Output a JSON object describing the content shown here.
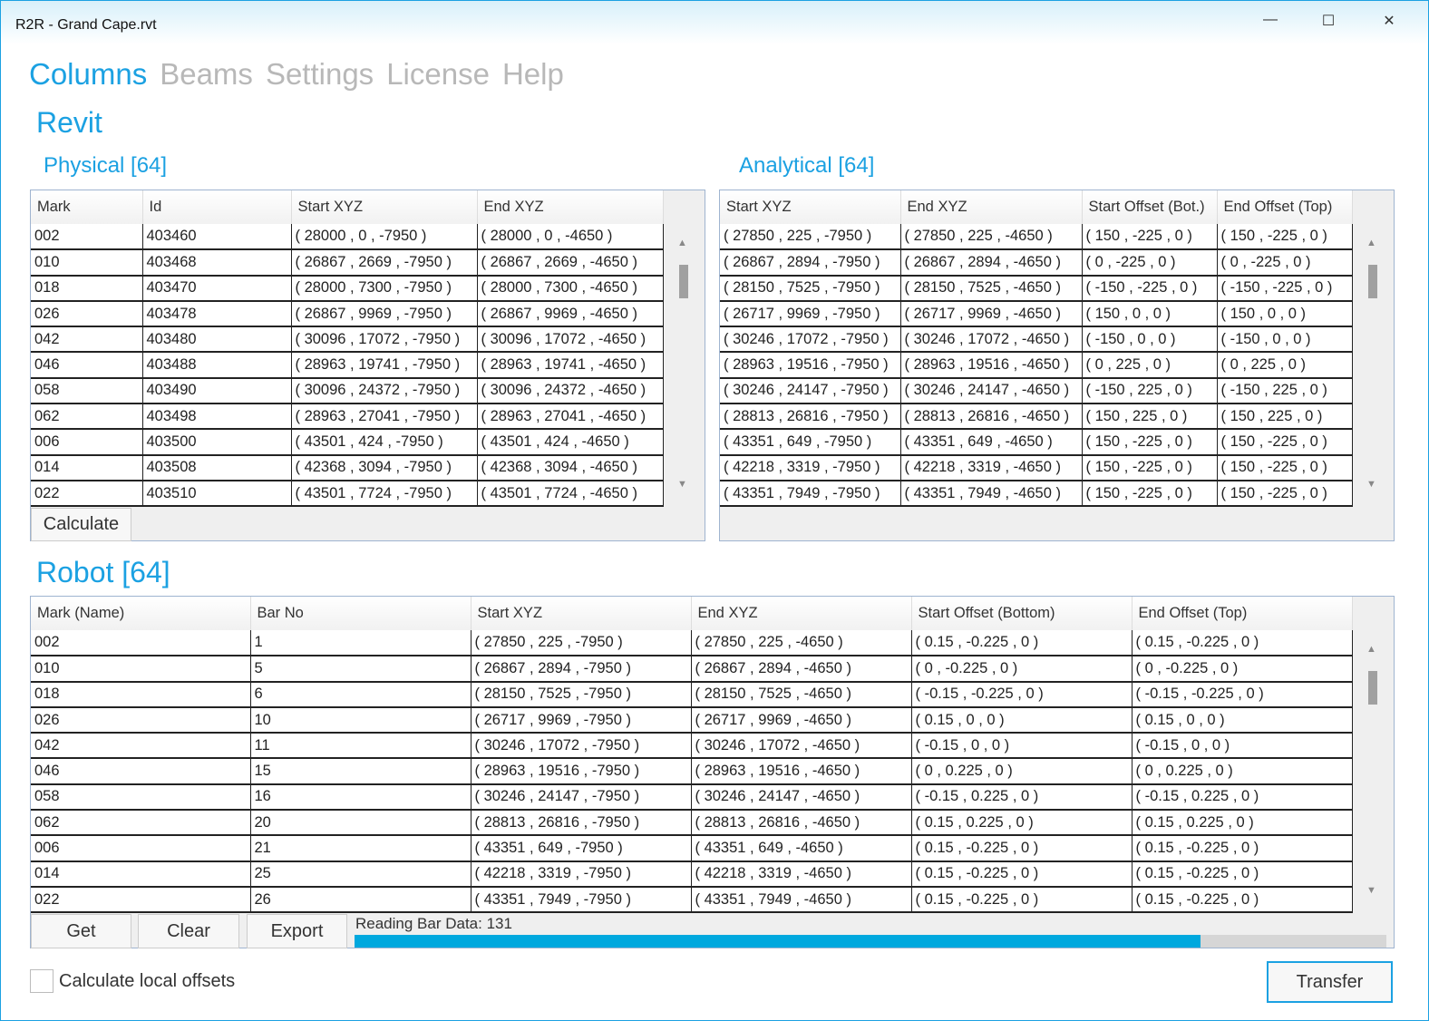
{
  "window": {
    "title": "R2R - Grand Cape.rvt",
    "minimize": "—",
    "maximize": "☐",
    "close": "✕"
  },
  "nav": [
    {
      "label": "Columns",
      "active": true
    },
    {
      "label": "Beams"
    },
    {
      "label": "Settings"
    },
    {
      "label": "License"
    },
    {
      "label": "Help"
    }
  ],
  "revit": {
    "title": "Revit",
    "physical": {
      "title": "Physical [64]",
      "headers": [
        "Mark",
        "Id",
        "Start XYZ",
        "End XYZ"
      ],
      "rows": [
        [
          "002",
          "403460",
          "( 28000 , 0 , -7950 )",
          "( 28000 , 0 , -4650 )"
        ],
        [
          "010",
          "403468",
          "( 26867 , 2669 , -7950 )",
          "( 26867 , 2669 , -4650 )"
        ],
        [
          "018",
          "403470",
          "( 28000 , 7300 , -7950 )",
          "( 28000 , 7300 , -4650 )"
        ],
        [
          "026",
          "403478",
          "( 26867 , 9969 , -7950 )",
          "( 26867 , 9969 , -4650 )"
        ],
        [
          "042",
          "403480",
          "( 30096 , 17072 , -7950 )",
          "( 30096 , 17072 , -4650 )"
        ],
        [
          "046",
          "403488",
          "( 28963 , 19741 , -7950 )",
          "( 28963 , 19741 , -4650 )"
        ],
        [
          "058",
          "403490",
          "( 30096 , 24372 , -7950 )",
          "( 30096 , 24372 , -4650 )"
        ],
        [
          "062",
          "403498",
          "( 28963 , 27041 , -7950 )",
          "( 28963 , 27041 , -4650 )"
        ],
        [
          "006",
          "403500",
          "( 43501 , 424 , -7950 )",
          "( 43501 , 424 , -4650 )"
        ],
        [
          "014",
          "403508",
          "( 42368 , 3094 , -7950 )",
          "( 42368 , 3094 , -4650 )"
        ],
        [
          "022",
          "403510",
          "( 43501 , 7724 , -7950 )",
          "( 43501 , 7724 , -4650 )"
        ]
      ],
      "calculate": "Calculate"
    },
    "analytical": {
      "title": "Analytical [64]",
      "headers": [
        "Start XYZ",
        "End XYZ",
        "Start Offset (Bot.)",
        "End Offset (Top)"
      ],
      "rows": [
        [
          "( 27850 , 225 , -7950 )",
          "( 27850 , 225 , -4650 )",
          "( 150 , -225 , 0 )",
          "( 150 , -225 , 0 )"
        ],
        [
          "( 26867 , 2894 , -7950 )",
          "( 26867 , 2894 , -4650 )",
          "( 0 , -225 , 0 )",
          "( 0 , -225 , 0 )"
        ],
        [
          "( 28150 , 7525 , -7950 )",
          "( 28150 , 7525 , -4650 )",
          "( -150 , -225 , 0 )",
          "( -150 , -225 , 0 )"
        ],
        [
          "( 26717 , 9969 , -7950 )",
          "( 26717 , 9969 , -4650 )",
          "( 150 , 0 , 0 )",
          "( 150 , 0 , 0 )"
        ],
        [
          "( 30246 , 17072 , -7950 )",
          "( 30246 , 17072 , -4650 )",
          "( -150 , 0 , 0 )",
          "( -150 , 0 , 0 )"
        ],
        [
          "( 28963 , 19516 , -7950 )",
          "( 28963 , 19516 , -4650 )",
          "( 0 , 225 , 0 )",
          "( 0 , 225 , 0 )"
        ],
        [
          "( 30246 , 24147 , -7950 )",
          "( 30246 , 24147 , -4650 )",
          "( -150 , 225 , 0 )",
          "( -150 , 225 , 0 )"
        ],
        [
          "( 28813 , 26816 , -7950 )",
          "( 28813 , 26816 , -4650 )",
          "( 150 , 225 , 0 )",
          "( 150 , 225 , 0 )"
        ],
        [
          "( 43351 , 649 , -7950 )",
          "( 43351 , 649 , -4650 )",
          "( 150 , -225 , 0 )",
          "( 150 , -225 , 0 )"
        ],
        [
          "( 42218 , 3319 , -7950 )",
          "( 42218 , 3319 , -4650 )",
          "( 150 , -225 , 0 )",
          "( 150 , -225 , 0 )"
        ],
        [
          "( 43351 , 7949 , -7950 )",
          "( 43351 , 7949 , -4650 )",
          "( 150 , -225 , 0 )",
          "( 150 , -225 , 0 )"
        ]
      ]
    }
  },
  "robot": {
    "title": "Robot [64]",
    "headers": [
      "Mark (Name)",
      "Bar No",
      "Start XYZ",
      "End XYZ",
      "Start Offset (Bottom)",
      "End Offset (Top)"
    ],
    "rows": [
      [
        "002",
        "1",
        "( 27850 , 225 , -7950 )",
        "( 27850 , 225 , -4650 )",
        "( 0.15 , -0.225 , 0 )",
        "( 0.15 , -0.225 , 0 )"
      ],
      [
        "010",
        "5",
        "( 26867 , 2894 , -7950 )",
        "( 26867 , 2894 , -4650 )",
        "( 0 , -0.225 , 0 )",
        "( 0 , -0.225 , 0 )"
      ],
      [
        "018",
        "6",
        "( 28150 , 7525 , -7950 )",
        "( 28150 , 7525 , -4650 )",
        "( -0.15 , -0.225 , 0 )",
        "( -0.15 , -0.225 , 0 )"
      ],
      [
        "026",
        "10",
        "( 26717 , 9969 , -7950 )",
        "( 26717 , 9969 , -4650 )",
        "( 0.15 , 0 , 0 )",
        "( 0.15 , 0 , 0 )"
      ],
      [
        "042",
        "11",
        "( 30246 , 17072 , -7950 )",
        "( 30246 , 17072 , -4650 )",
        "( -0.15 , 0 , 0 )",
        "( -0.15 , 0 , 0 )"
      ],
      [
        "046",
        "15",
        "( 28963 , 19516 , -7950 )",
        "( 28963 , 19516 , -4650 )",
        "( 0 , 0.225 , 0 )",
        "( 0 , 0.225 , 0 )"
      ],
      [
        "058",
        "16",
        "( 30246 , 24147 , -7950 )",
        "( 30246 , 24147 , -4650 )",
        "( -0.15 , 0.225 , 0 )",
        "( -0.15 , 0.225 , 0 )"
      ],
      [
        "062",
        "20",
        "( 28813 , 26816 , -7950 )",
        "( 28813 , 26816 , -4650 )",
        "( 0.15 , 0.225 , 0 )",
        "( 0.15 , 0.225 , 0 )"
      ],
      [
        "006",
        "21",
        "( 43351 , 649 , -7950 )",
        "( 43351 , 649 , -4650 )",
        "( 0.15 , -0.225 , 0 )",
        "( 0.15 , -0.225 , 0 )"
      ],
      [
        "014",
        "25",
        "( 42218 , 3319 , -7950 )",
        "( 42218 , 3319 , -4650 )",
        "( 0.15 , -0.225 , 0 )",
        "( 0.15 , -0.225 , 0 )"
      ],
      [
        "022",
        "26",
        "( 43351 , 7949 , -7950 )",
        "( 43351 , 7949 , -4650 )",
        "( 0.15 , -0.225 , 0 )",
        "( 0.15 , -0.225 , 0 )"
      ]
    ],
    "get": "Get",
    "clear": "Clear",
    "export": "Export",
    "status": "Reading Bar Data: 131",
    "progress": 0.82
  },
  "options": {
    "local_offsets_label": "Calculate local offsets",
    "local_offsets_checked": false
  },
  "transfer": "Transfer"
}
